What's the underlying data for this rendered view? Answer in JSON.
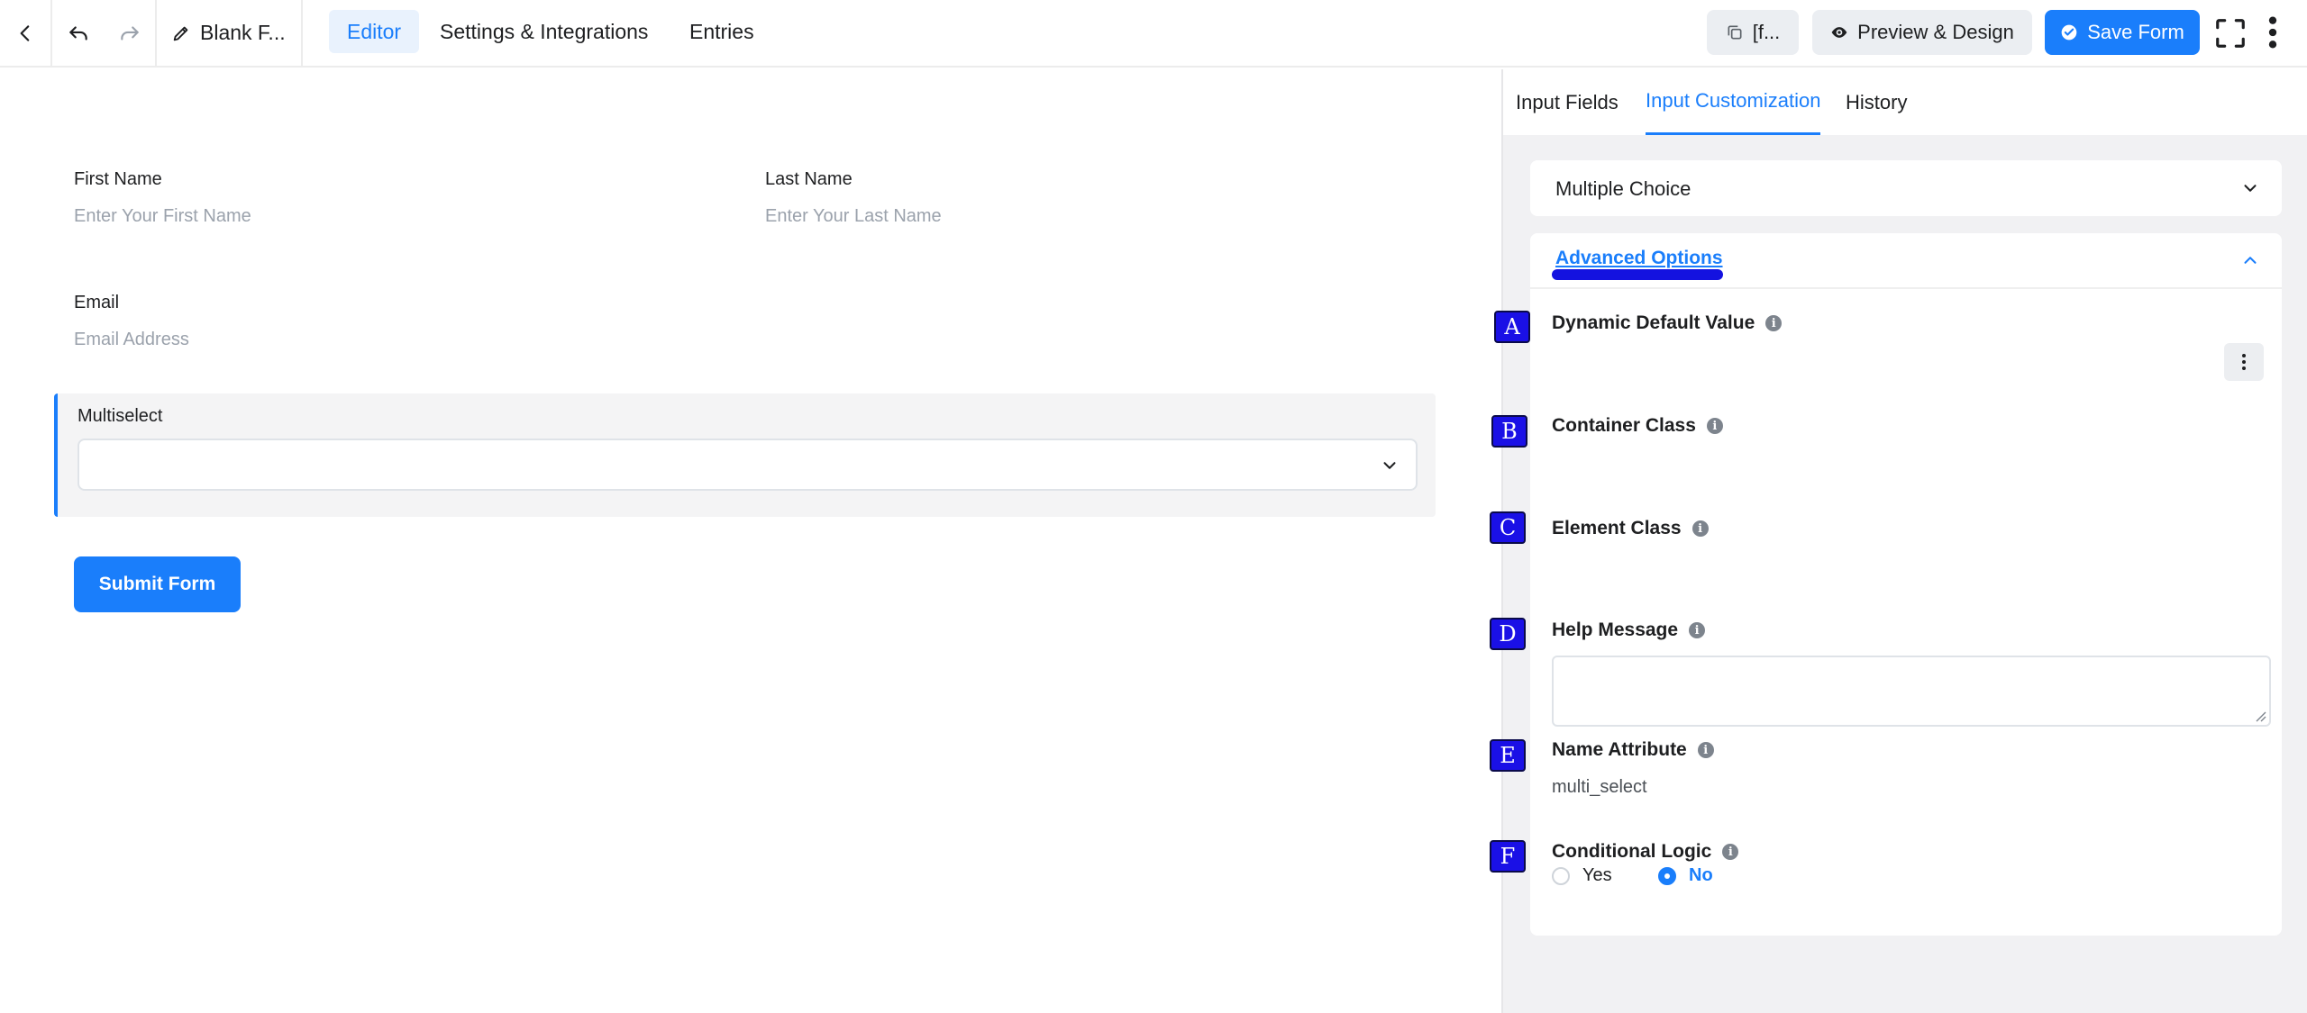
{
  "topbar": {
    "doc_title": "Blank F...",
    "tabs": [
      "Editor",
      "Settings & Integrations",
      "Entries"
    ],
    "shortcode_label": "[f...",
    "preview_label": "Preview & Design",
    "save_label": "Save Form"
  },
  "form": {
    "first_name": {
      "label": "First Name",
      "placeholder": "Enter Your First Name"
    },
    "last_name": {
      "label": "Last Name",
      "placeholder": "Enter Your Last Name"
    },
    "email": {
      "label": "Email",
      "placeholder": "Email Address"
    },
    "multiselect": {
      "label": "Multiselect"
    },
    "submit_label": "Submit Form"
  },
  "panel": {
    "tabs": [
      "Input Fields",
      "Input Customization",
      "History"
    ],
    "active_tab": "Input Customization",
    "multiple_choice": "Multiple Choice",
    "advanced": {
      "title": "Advanced Options",
      "dynamic_default": "Dynamic Default Value",
      "container_class": "Container Class",
      "element_class": "Element Class",
      "help_message": "Help Message",
      "name_attribute": "Name Attribute",
      "name_attribute_value": "multi_select",
      "conditional_logic": "Conditional Logic",
      "yes": "Yes",
      "no": "No",
      "conditional_selected": "No"
    }
  },
  "markers": [
    "A",
    "B",
    "C",
    "D",
    "E",
    "F"
  ],
  "colors": {
    "accent": "#1a7efb",
    "marker": "#1a10e6"
  }
}
